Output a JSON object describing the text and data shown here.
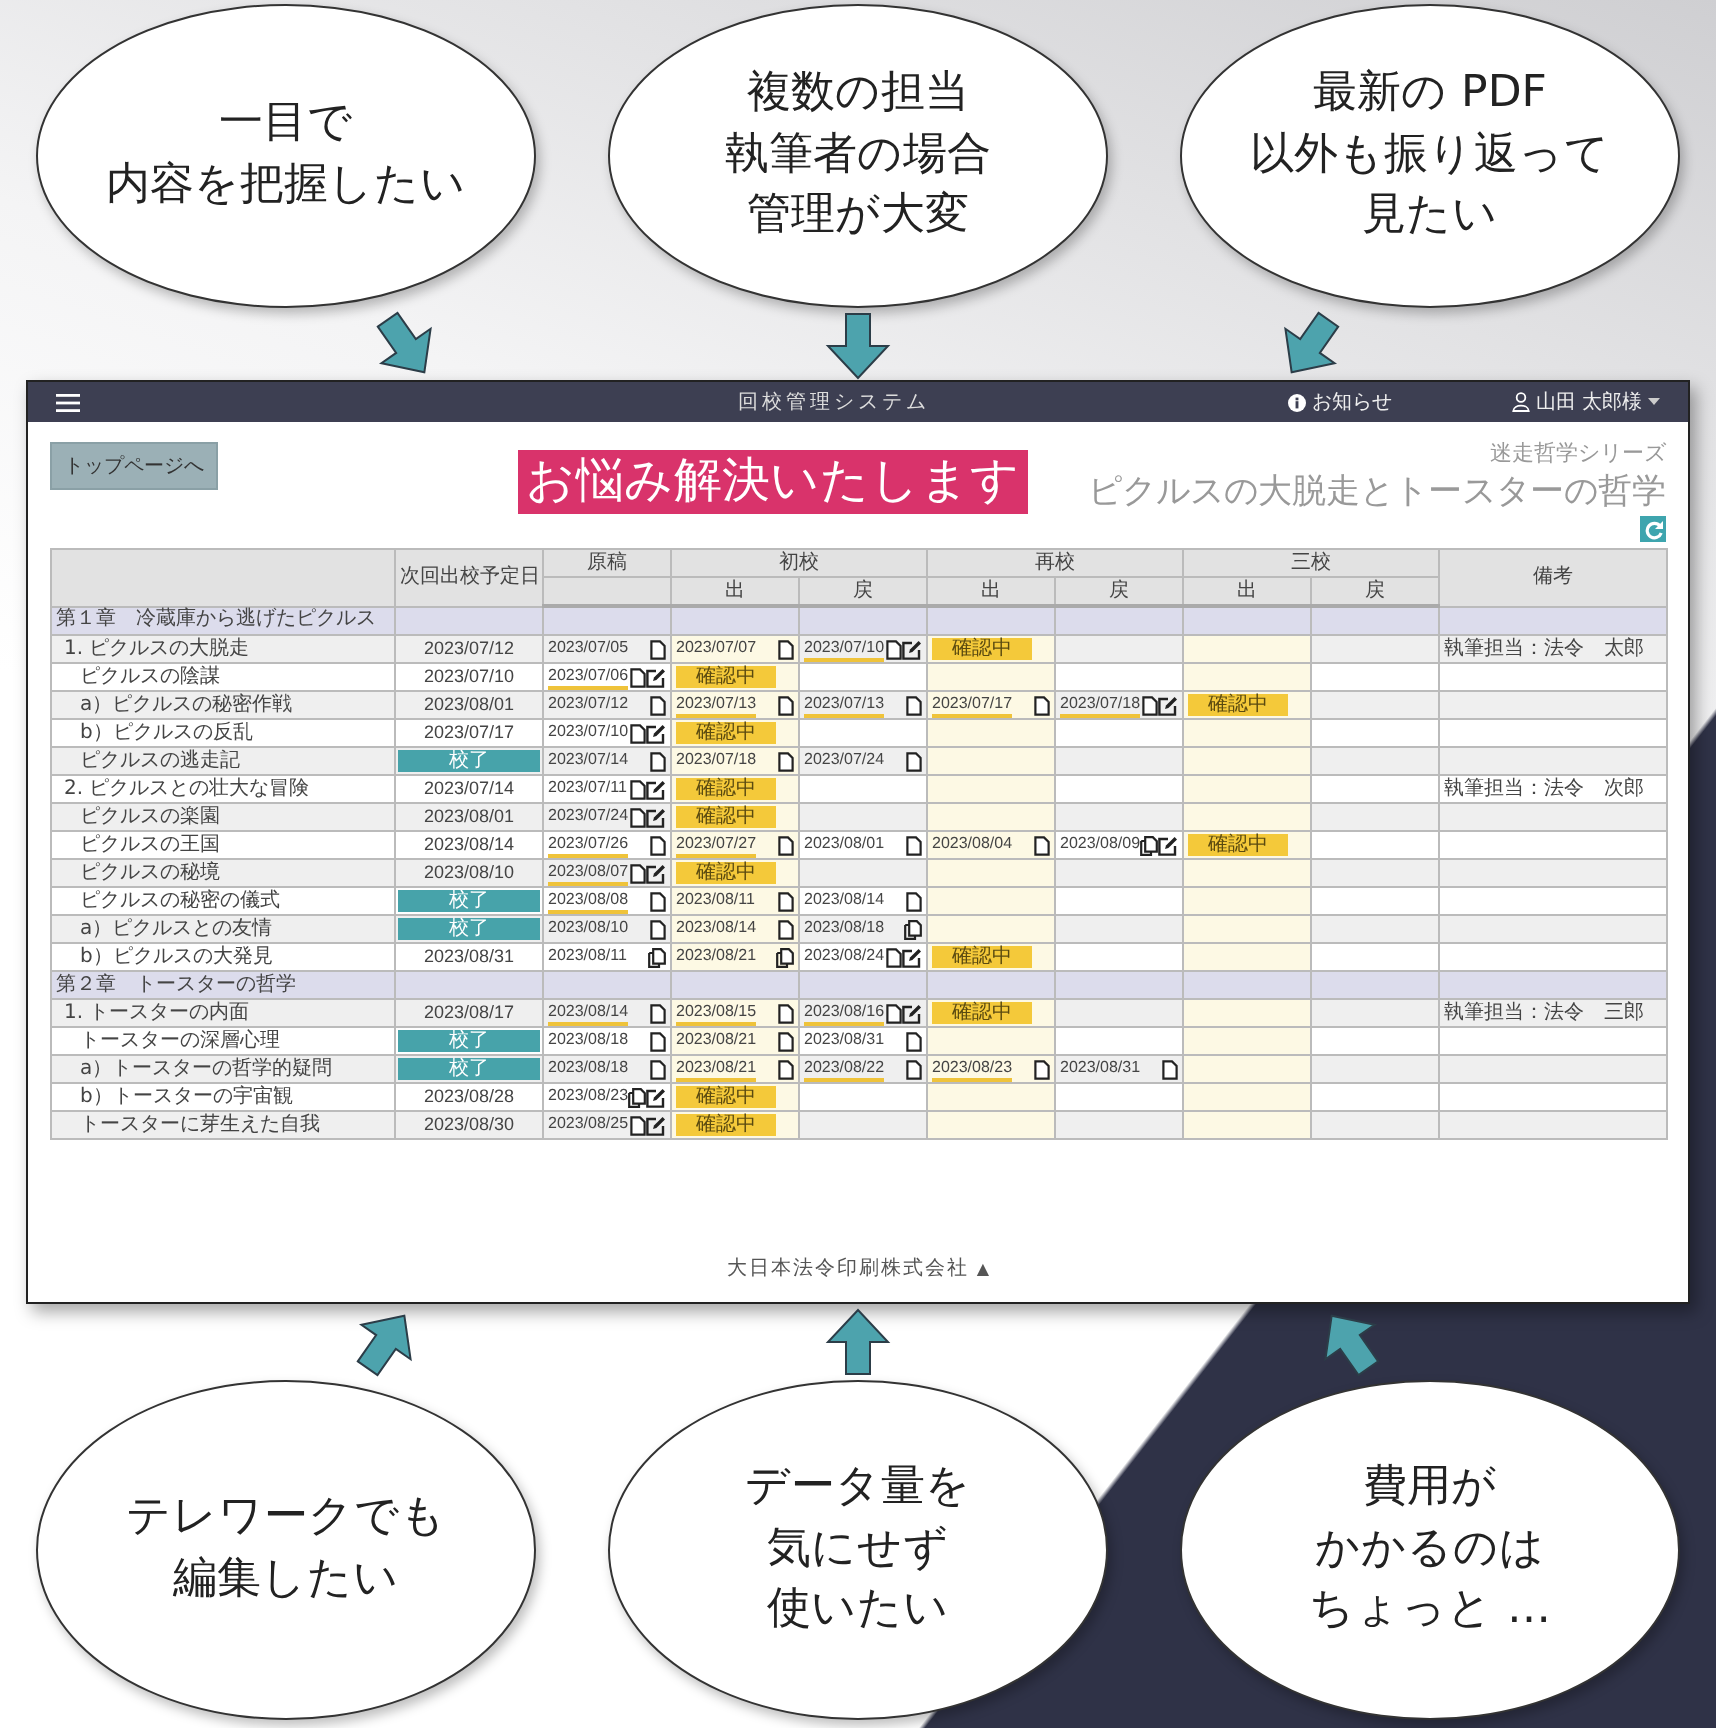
{
  "top_bubbles": [
    {
      "lines": [
        "一目で",
        "内容を把握したい"
      ]
    },
    {
      "lines": [
        "複数の担当",
        "執筆者の場合",
        "管理が大変"
      ]
    },
    {
      "lines": [
        "最新の PDF",
        "以外も振り返って",
        "見たい"
      ]
    }
  ],
  "navbar": {
    "title": "回校管理システム",
    "notice": "お知らせ",
    "user": "山田 太郎様"
  },
  "top_button": "トップページへ",
  "banner": "お悩み解決いたします",
  "series": "迷走哲学シリーズ",
  "book_title": "ピクルスの大脱走とトースターの哲学",
  "table": {
    "head": {
      "next": "次回出校予定日",
      "stages": [
        "原稿",
        "初校",
        "再校",
        "三校"
      ],
      "subheads": [
        "出",
        "戻",
        "出",
        "戻",
        "出",
        "戻"
      ],
      "note": "備考"
    },
    "rows": [
      {
        "kind": "chapter",
        "title": "第１章　冷蔵庫から逃げたピクルス"
      },
      {
        "kind": "section",
        "title": "1.  ピクルスの大脱走",
        "next": {
          "kind": "date",
          "text": "2023/07/12"
        },
        "cells": [
          {
            "kind": "file",
            "date": "2023/07/05",
            "marked": false,
            "edit": false
          },
          {
            "kind": "file",
            "date": "2023/07/07",
            "marked": false,
            "edit": false
          },
          {
            "kind": "file",
            "date": "2023/07/10",
            "marked": true,
            "edit": true
          },
          {
            "kind": "badge",
            "text": "確認中"
          },
          null,
          null,
          null
        ],
        "note": "執筆担当：法令　太郎"
      },
      {
        "kind": "item",
        "title": "ピクルスの陰謀",
        "next": {
          "kind": "date",
          "text": "2023/07/10"
        },
        "cells": [
          {
            "kind": "file",
            "date": "2023/07/06",
            "marked": true,
            "edit": true
          },
          {
            "kind": "badge",
            "text": "確認中"
          },
          null,
          null,
          null,
          null,
          null
        ]
      },
      {
        "kind": "item",
        "title": "a）ピクルスの秘密作戦",
        "next": {
          "kind": "date",
          "text": "2023/08/01"
        },
        "cells": [
          {
            "kind": "file",
            "date": "2023/07/12",
            "marked": false,
            "edit": false
          },
          {
            "kind": "file",
            "date": "2023/07/13",
            "marked": true,
            "edit": false
          },
          {
            "kind": "file",
            "date": "2023/07/13",
            "marked": true,
            "edit": false
          },
          {
            "kind": "file",
            "date": "2023/07/17",
            "marked": true,
            "edit": false
          },
          {
            "kind": "file",
            "date": "2023/07/18",
            "marked": true,
            "edit": true
          },
          {
            "kind": "badge",
            "text": "確認中"
          },
          null
        ]
      },
      {
        "kind": "item",
        "title": "b）ピクルスの反乱",
        "next": {
          "kind": "date",
          "text": "2023/07/17"
        },
        "cells": [
          {
            "kind": "file",
            "date": "2023/07/10",
            "marked": false,
            "edit": true
          },
          {
            "kind": "badge",
            "text": "確認中"
          },
          null,
          null,
          null,
          null,
          null
        ]
      },
      {
        "kind": "item",
        "title": "ピクルスの逃走記",
        "next": {
          "kind": "done",
          "text": "校了"
        },
        "cells": [
          {
            "kind": "file",
            "date": "2023/07/14",
            "marked": false,
            "edit": false
          },
          {
            "kind": "file",
            "date": "2023/07/18",
            "marked": false,
            "edit": false
          },
          {
            "kind": "file",
            "date": "2023/07/24",
            "marked": false,
            "edit": false
          },
          null,
          null,
          null,
          null
        ]
      },
      {
        "kind": "section",
        "title": "2.  ピクルスとの壮大な冒険",
        "next": {
          "kind": "date",
          "text": "2023/07/14"
        },
        "cells": [
          {
            "kind": "file",
            "date": "2023/07/11",
            "marked": false,
            "edit": true
          },
          {
            "kind": "badge",
            "text": "確認中"
          },
          null,
          null,
          null,
          null,
          null
        ],
        "note": "執筆担当：法令　次郎"
      },
      {
        "kind": "item",
        "title": "ピクルスの楽園",
        "next": {
          "kind": "date",
          "text": "2023/08/01"
        },
        "cells": [
          {
            "kind": "file",
            "date": "2023/07/24",
            "marked": false,
            "edit": true
          },
          {
            "kind": "badge",
            "text": "確認中"
          },
          null,
          null,
          null,
          null,
          null
        ]
      },
      {
        "kind": "item",
        "title": "ピクルスの王国",
        "next": {
          "kind": "date",
          "text": "2023/08/14"
        },
        "cells": [
          {
            "kind": "file",
            "date": "2023/07/26",
            "marked": true,
            "edit": false
          },
          {
            "kind": "file",
            "date": "2023/07/27",
            "marked": true,
            "edit": false
          },
          {
            "kind": "file",
            "date": "2023/08/01",
            "marked": false,
            "edit": false
          },
          {
            "kind": "file",
            "date": "2023/08/04",
            "marked": false,
            "edit": false
          },
          {
            "kind": "files",
            "date": "2023/08/09",
            "marked": false,
            "edit": true
          },
          {
            "kind": "badge",
            "text": "確認中"
          },
          null
        ]
      },
      {
        "kind": "item",
        "title": "ピクルスの秘境",
        "next": {
          "kind": "date",
          "text": "2023/08/10"
        },
        "cells": [
          {
            "kind": "file",
            "date": "2023/08/07",
            "marked": true,
            "edit": true
          },
          {
            "kind": "badge",
            "text": "確認中"
          },
          null,
          null,
          null,
          null,
          null
        ]
      },
      {
        "kind": "item",
        "title": "ピクルスの秘密の儀式",
        "next": {
          "kind": "done",
          "text": "校了"
        },
        "cells": [
          {
            "kind": "file",
            "date": "2023/08/08",
            "marked": true,
            "edit": false
          },
          {
            "kind": "file",
            "date": "2023/08/11",
            "marked": false,
            "edit": false
          },
          {
            "kind": "file",
            "date": "2023/08/14",
            "marked": false,
            "edit": false
          },
          null,
          null,
          null,
          null
        ]
      },
      {
        "kind": "item",
        "title": "a）ピクルスとの友情",
        "next": {
          "kind": "done",
          "text": "校了"
        },
        "cells": [
          {
            "kind": "file",
            "date": "2023/08/10",
            "marked": false,
            "edit": false
          },
          {
            "kind": "file",
            "date": "2023/08/14",
            "marked": false,
            "edit": false
          },
          {
            "kind": "files",
            "date": "2023/08/18",
            "marked": false,
            "edit": false
          },
          null,
          null,
          null,
          null
        ]
      },
      {
        "kind": "item",
        "title": "b）ピクルスの大発見",
        "next": {
          "kind": "date",
          "text": "2023/08/31"
        },
        "cells": [
          {
            "kind": "files",
            "date": "2023/08/11",
            "marked": false,
            "edit": false
          },
          {
            "kind": "files",
            "date": "2023/08/21",
            "marked": false,
            "edit": false
          },
          {
            "kind": "file",
            "date": "2023/08/24",
            "marked": false,
            "edit": true
          },
          {
            "kind": "badge",
            "text": "確認中"
          },
          null,
          null,
          null
        ]
      },
      {
        "kind": "chapter",
        "title": "第２章　トースターの哲学"
      },
      {
        "kind": "section",
        "title": "1.  トースターの内面",
        "next": {
          "kind": "date",
          "text": "2023/08/17"
        },
        "cells": [
          {
            "kind": "file",
            "date": "2023/08/14",
            "marked": true,
            "edit": false
          },
          {
            "kind": "file",
            "date": "2023/08/15",
            "marked": true,
            "edit": false
          },
          {
            "kind": "file",
            "date": "2023/08/16",
            "marked": true,
            "edit": true
          },
          {
            "kind": "badge",
            "text": "確認中"
          },
          null,
          null,
          null
        ],
        "note": "執筆担当：法令　三郎"
      },
      {
        "kind": "item",
        "title": "トースターの深層心理",
        "next": {
          "kind": "done",
          "text": "校了"
        },
        "cells": [
          {
            "kind": "file",
            "date": "2023/08/18",
            "marked": false,
            "edit": false
          },
          {
            "kind": "file",
            "date": "2023/08/21",
            "marked": false,
            "edit": false
          },
          {
            "kind": "file",
            "date": "2023/08/31",
            "marked": false,
            "edit": false
          },
          null,
          null,
          null,
          null
        ]
      },
      {
        "kind": "item",
        "title": "a）トースターの哲学的疑問",
        "next": {
          "kind": "done",
          "text": "校了"
        },
        "cells": [
          {
            "kind": "file",
            "date": "2023/08/18",
            "marked": false,
            "edit": false
          },
          {
            "kind": "file",
            "date": "2023/08/21",
            "marked": true,
            "edit": false
          },
          {
            "kind": "file",
            "date": "2023/08/22",
            "marked": true,
            "edit": false
          },
          {
            "kind": "file",
            "date": "2023/08/23",
            "marked": true,
            "edit": false
          },
          {
            "kind": "file",
            "date": "2023/08/31",
            "marked": false,
            "edit": false
          },
          null,
          null
        ]
      },
      {
        "kind": "item",
        "title": "b）トースターの宇宙観",
        "next": {
          "kind": "date",
          "text": "2023/08/28"
        },
        "cells": [
          {
            "kind": "files",
            "date": "2023/08/23",
            "marked": false,
            "edit": true
          },
          {
            "kind": "badge",
            "text": "確認中"
          },
          null,
          null,
          null,
          null,
          null
        ]
      },
      {
        "kind": "item",
        "title": "トースターに芽生えた自我",
        "next": {
          "kind": "date",
          "text": "2023/08/30"
        },
        "cells": [
          {
            "kind": "file",
            "date": "2023/08/25",
            "marked": false,
            "edit": true
          },
          {
            "kind": "badge",
            "text": "確認中"
          },
          null,
          null,
          null,
          null,
          null
        ]
      }
    ]
  },
  "footer": {
    "text": "大日本法令印刷株式会社",
    "mark": "▲"
  },
  "bottom_bubbles": [
    {
      "lines": [
        "テレワークでも",
        "編集したい"
      ]
    },
    {
      "lines": [
        "データ量を",
        "気にせず",
        "使いたい"
      ]
    },
    {
      "lines": [
        "費用が",
        "かかるのは",
        "ちょっと …"
      ]
    }
  ]
}
